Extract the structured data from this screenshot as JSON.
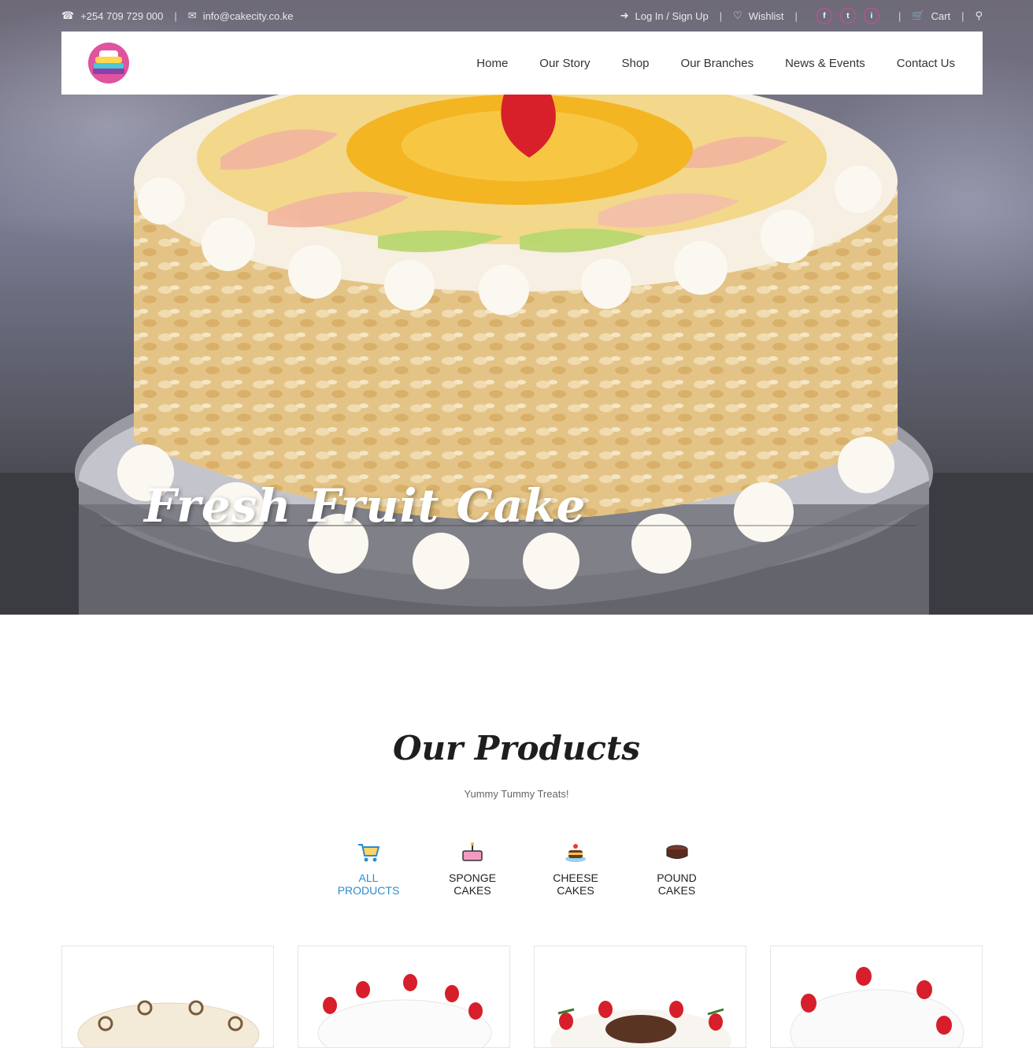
{
  "topbar": {
    "phone": "+254 709 729 000",
    "email": "info@cakecity.co.ke",
    "login": "Log In / Sign Up",
    "wishlist": "Wishlist",
    "cart": "Cart",
    "social": [
      "f",
      "t",
      "i"
    ]
  },
  "nav": {
    "items": [
      "Home",
      "Our Story",
      "Shop",
      "Our Branches",
      "News & Events",
      "Contact Us"
    ]
  },
  "hero": {
    "title": "Fresh Fruit Cake"
  },
  "products": {
    "title": "Our Products",
    "subtitle": "Yummy Tummy Treats!",
    "categories": [
      {
        "label": "ALL PRODUCTS",
        "icon": "shopping-cart-icon"
      },
      {
        "label": "SPONGE CAKES",
        "icon": "birthday-cake-icon"
      },
      {
        "label": "CHEESE CAKES",
        "icon": "cheese-cake-icon"
      },
      {
        "label": "POUND CAKES",
        "icon": "pound-cake-icon"
      }
    ],
    "active_category_color": "#2d8ccf"
  },
  "colors": {
    "accent_pink": "#d04a9c",
    "active_blue": "#2d8ccf"
  }
}
